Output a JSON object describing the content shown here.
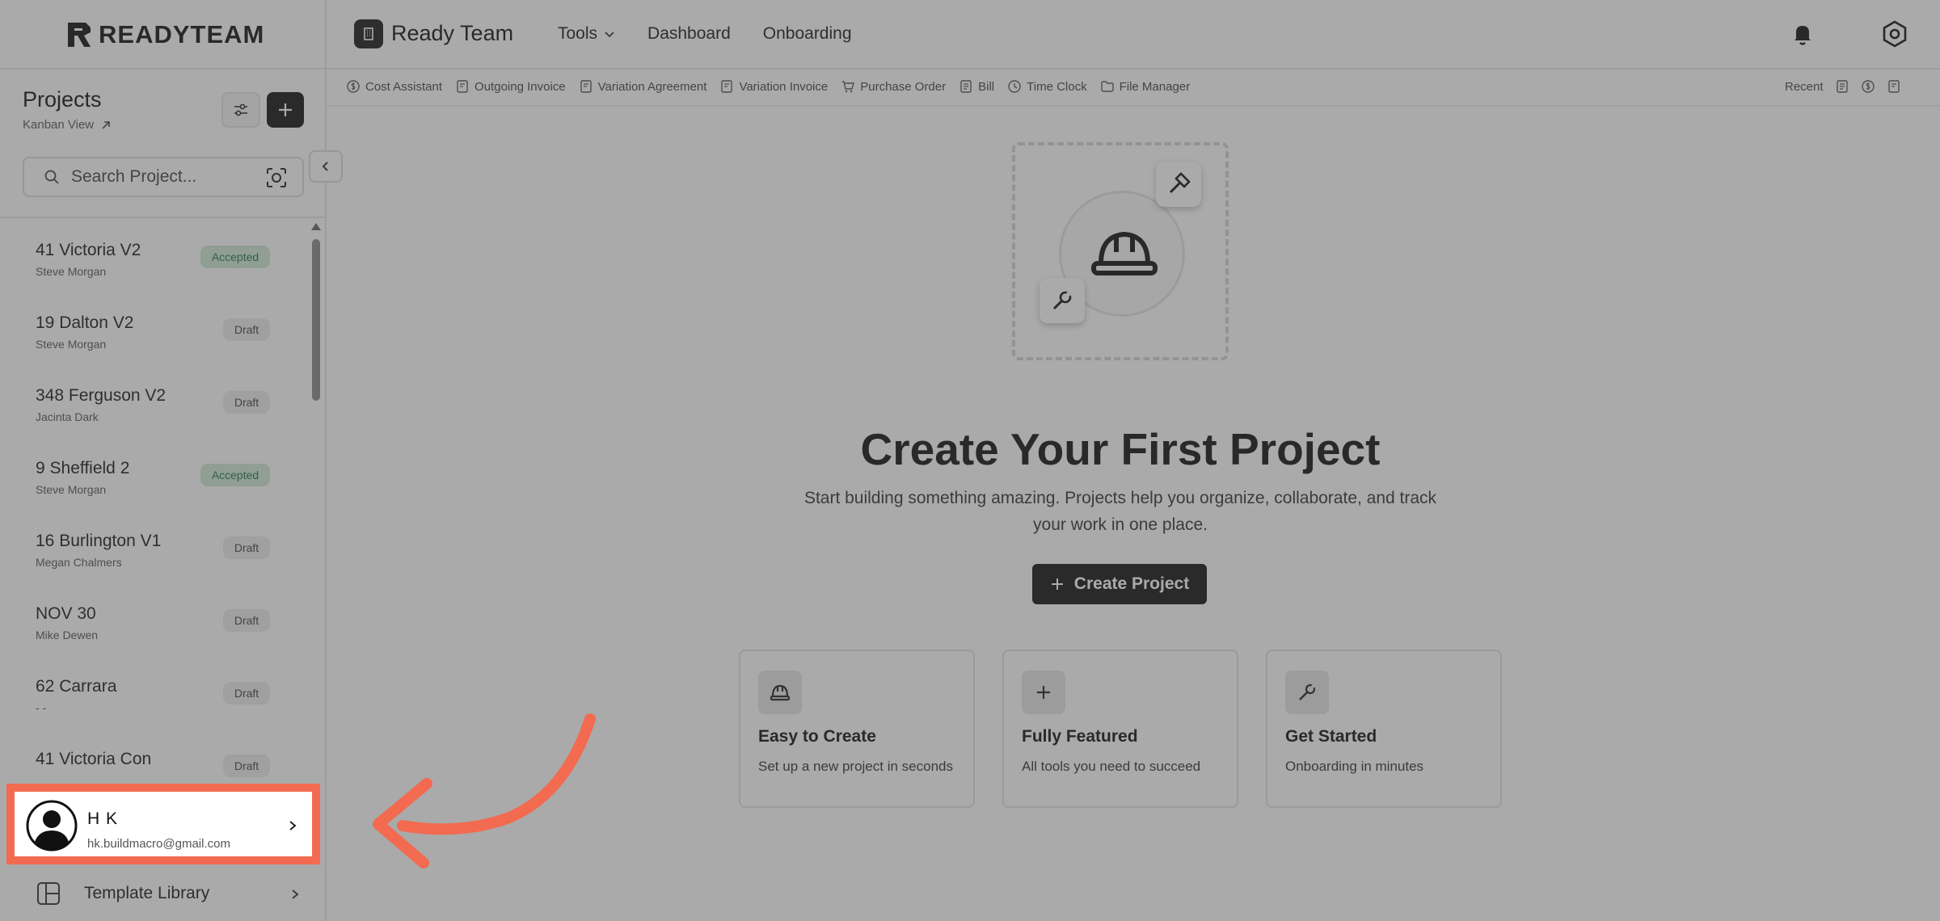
{
  "brand": {
    "logo_text": "READYTEAM"
  },
  "sidebar": {
    "title": "Projects",
    "kanban_link": "Kanban View",
    "search_placeholder": "Search Project...",
    "projects": [
      {
        "name": "41 Victoria V2",
        "owner": "Steve Morgan",
        "status": "Accepted"
      },
      {
        "name": "19 Dalton V2",
        "owner": "Steve Morgan",
        "status": "Draft"
      },
      {
        "name": "348 Ferguson V2",
        "owner": "Jacinta Dark",
        "status": "Draft"
      },
      {
        "name": "9 Sheffield 2",
        "owner": "Steve Morgan",
        "status": "Accepted"
      },
      {
        "name": "16 Burlington V1",
        "owner": "Megan Chalmers",
        "status": "Draft"
      },
      {
        "name": "NOV 30",
        "owner": "Mike Dewen",
        "status": "Draft"
      },
      {
        "name": "62 Carrara",
        "owner": "- -",
        "status": "Draft"
      },
      {
        "name": "41 Victoria Con",
        "owner": "",
        "status": "Draft"
      }
    ],
    "user": {
      "name": "H K",
      "email": "hk.buildmacro@gmail.com"
    },
    "template_library": "Template Library"
  },
  "header": {
    "workspace": "Ready Team",
    "nav": {
      "tools": "Tools",
      "dashboard": "Dashboard",
      "onboarding": "Onboarding"
    }
  },
  "toolbar": {
    "items": [
      "Cost Assistant",
      "Outgoing Invoice",
      "Variation Agreement",
      "Variation Invoice",
      "Purchase Order",
      "Bill",
      "Time Clock",
      "File Manager"
    ],
    "recent_label": "Recent"
  },
  "main": {
    "title": "Create Your First Project",
    "subtitle": "Start building something amazing. Projects help you organize, collaborate, and track your work in one place.",
    "create_button": "Create Project",
    "cards": [
      {
        "title": "Easy to Create",
        "desc": "Set up a new project in seconds"
      },
      {
        "title": "Fully Featured",
        "desc": "All tools you need to succeed"
      },
      {
        "title": "Get Started",
        "desc": "Onboarding in minutes"
      }
    ]
  },
  "colors": {
    "highlight": "#f26b50",
    "accepted_bg": "#cfe9d7",
    "accepted_text": "#24754a"
  }
}
